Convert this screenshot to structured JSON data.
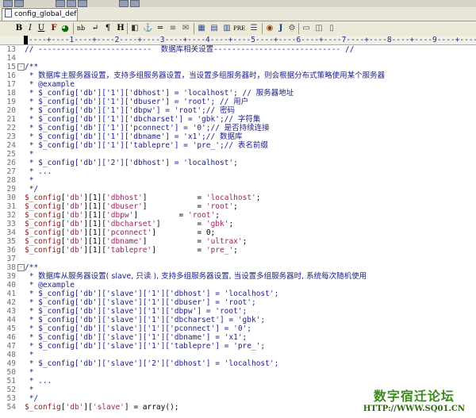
{
  "tab": {
    "label": "config_global_defa"
  },
  "toolbar": {
    "bold": "B",
    "italic": "I",
    "underline": "U",
    "func": "F",
    "nbsp": "nb",
    "br": "↵",
    "para": "¶",
    "heading": "H",
    "anchor": "⚓",
    "hr": "═",
    "table": "▦",
    "css": "PRE",
    "ie": "J"
  },
  "ruler": "----+----1----+----2----+----3----+----4----+----5----+----6----+----7----+----8----+----9----+----0--",
  "lines": [
    {
      "n": "13",
      "fold": "",
      "html": "<span class='cmt'>// -------------------------  <span class='cn'>数据库相关设置</span>---------------------------- //</span>"
    },
    {
      "n": "14",
      "fold": "",
      "html": ""
    },
    {
      "n": "15",
      "fold": "⊟",
      "html": "<span class='cmt'>/**</span>"
    },
    {
      "n": "16",
      "fold": "",
      "html": "<span class='cmt'> * <span class='cn'>数据库主服务器设置，支持多组服务器设置，当设置多组服务器时，则会根据分布式策略使用某个服务器</span></span>"
    },
    {
      "n": "17",
      "fold": "",
      "html": "<span class='cmt'> * @example</span>"
    },
    {
      "n": "18",
      "fold": "",
      "html": "<span class='cmt'> * $_config['db']['1']['dbhost'] = 'localhost'; // <span class='cn'>服务器地址</span></span>"
    },
    {
      "n": "19",
      "fold": "",
      "html": "<span class='cmt'> * $_config['db']['1']['dbuser'] = 'root'; // <span class='cn'>用户</span></span>"
    },
    {
      "n": "20",
      "fold": "",
      "html": "<span class='cmt'> * $_config['db']['1']['dbpw'] = 'root';// <span class='cn'>密码</span></span>"
    },
    {
      "n": "21",
      "fold": "",
      "html": "<span class='cmt'> * $_config['db']['1']['dbcharset'] = 'gbk';// <span class='cn'>字符集</span></span>"
    },
    {
      "n": "22",
      "fold": "",
      "html": "<span class='cmt'> * $_config['db']['1']['pconnect'] = '0';// <span class='cn'>是否持续连接</span></span>"
    },
    {
      "n": "23",
      "fold": "",
      "html": "<span class='cmt'> * $_config['db']['1']['dbname'] = 'x1';// <span class='cn'>数据库</span></span>"
    },
    {
      "n": "24",
      "fold": "",
      "html": "<span class='cmt'> * $_config['db']['1']['tablepre'] = 'pre_';// <span class='cn'>表名前缀</span></span>"
    },
    {
      "n": "25",
      "fold": "",
      "html": "<span class='cmt'> *</span>"
    },
    {
      "n": "26",
      "fold": "",
      "html": "<span class='cmt'> * $_config['db']['2']['dbhost'] = 'localhost';</span>"
    },
    {
      "n": "27",
      "fold": "",
      "html": "<span class='cmt'> * ...</span>"
    },
    {
      "n": "28",
      "fold": "",
      "html": "<span class='cmt'> *</span>"
    },
    {
      "n": "29",
      "fold": "",
      "html": "<span class='cmt'> */</span>"
    },
    {
      "n": "30",
      "fold": "",
      "html": "<span class='var'>$_config</span>[<span class='str'>'db'</span>][1][<span class='str'>'dbhost'</span>]           = <span class='str'>'localhost'</span>;"
    },
    {
      "n": "31",
      "fold": "",
      "html": "<span class='var'>$_config</span>[<span class='str'>'db'</span>][1][<span class='str'>'dbuser'</span>]           = <span class='str'>'root'</span>;"
    },
    {
      "n": "32",
      "fold": "",
      "html": "<span class='var'>$_config</span>[<span class='str'>'db'</span>][1][<span class='str'>'dbpw'</span>]         = <span class='str'>'root'</span>;"
    },
    {
      "n": "33",
      "fold": "",
      "html": "<span class='var'>$_config</span>[<span class='str'>'db'</span>][1][<span class='str'>'dbcharset'</span>]        = <span class='str'>'gbk'</span>;"
    },
    {
      "n": "34",
      "fold": "",
      "html": "<span class='var'>$_config</span>[<span class='str'>'db'</span>][1][<span class='str'>'pconnect'</span>]         = 0;"
    },
    {
      "n": "35",
      "fold": "",
      "html": "<span class='var'>$_config</span>[<span class='str'>'db'</span>][1][<span class='str'>'dbname'</span>]           = <span class='str'>'ultrax'</span>;"
    },
    {
      "n": "36",
      "fold": "",
      "html": "<span class='var'>$_config</span>[<span class='str'>'db'</span>][1][<span class='str'>'tablepre'</span>]         = <span class='str'>'pre_'</span>;"
    },
    {
      "n": "37",
      "fold": "",
      "html": ""
    },
    {
      "n": "38",
      "fold": "⊟",
      "html": "<span class='cmt'>/**</span>"
    },
    {
      "n": "39",
      "fold": "",
      "html": "<span class='cmt'> * <span class='cn'>数据库从服务器设置( slave, 只读 ), 支持多组服务器设置, 当设置多组服务器时, 系统每次随机使用</span></span>"
    },
    {
      "n": "40",
      "fold": "",
      "html": "<span class='cmt'> * @example</span>"
    },
    {
      "n": "41",
      "fold": "",
      "html": "<span class='cmt'> * $_config['db']['slave']['1']['dbhost'] = 'localhost';</span>"
    },
    {
      "n": "42",
      "fold": "",
      "html": "<span class='cmt'> * $_config['db']['slave']['1']['dbuser'] = 'root';</span>"
    },
    {
      "n": "43",
      "fold": "",
      "html": "<span class='cmt'> * $_config['db']['slave']['1']['dbpw'] = 'root';</span>"
    },
    {
      "n": "44",
      "fold": "",
      "html": "<span class='cmt'> * $_config['db']['slave']['1']['dbcharset'] = 'gbk';</span>"
    },
    {
      "n": "45",
      "fold": "",
      "html": "<span class='cmt'> * $_config['db']['slave']['1']['pconnect'] = '0';</span>"
    },
    {
      "n": "46",
      "fold": "",
      "html": "<span class='cmt'> * $_config['db']['slave']['1']['dbname'] = 'x1';</span>"
    },
    {
      "n": "47",
      "fold": "",
      "html": "<span class='cmt'> * $_config['db']['slave']['1']['tablepre'] = 'pre_';</span>"
    },
    {
      "n": "48",
      "fold": "",
      "html": "<span class='cmt'> *</span>"
    },
    {
      "n": "49",
      "fold": "",
      "html": "<span class='cmt'> * $_config['db']['slave']['2']['dbhost'] = 'localhost';</span>"
    },
    {
      "n": "50",
      "fold": "",
      "html": "<span class='cmt'> *</span>"
    },
    {
      "n": "51",
      "fold": "",
      "html": "<span class='cmt'> * ...</span>"
    },
    {
      "n": "52",
      "fold": "",
      "html": "<span class='cmt'> *</span>"
    },
    {
      "n": "53",
      "fold": "",
      "html": "<span class='cmt'> */</span>"
    },
    {
      "n": "54",
      "fold": "",
      "html": "<span class='var'>$_config</span>[<span class='str'>'db'</span>][<span class='str'>'slave'</span>] = array();"
    }
  ],
  "watermark": {
    "cn": "数字宿迁论坛",
    "url": "HTTP://WWW.SQ01.CN"
  }
}
